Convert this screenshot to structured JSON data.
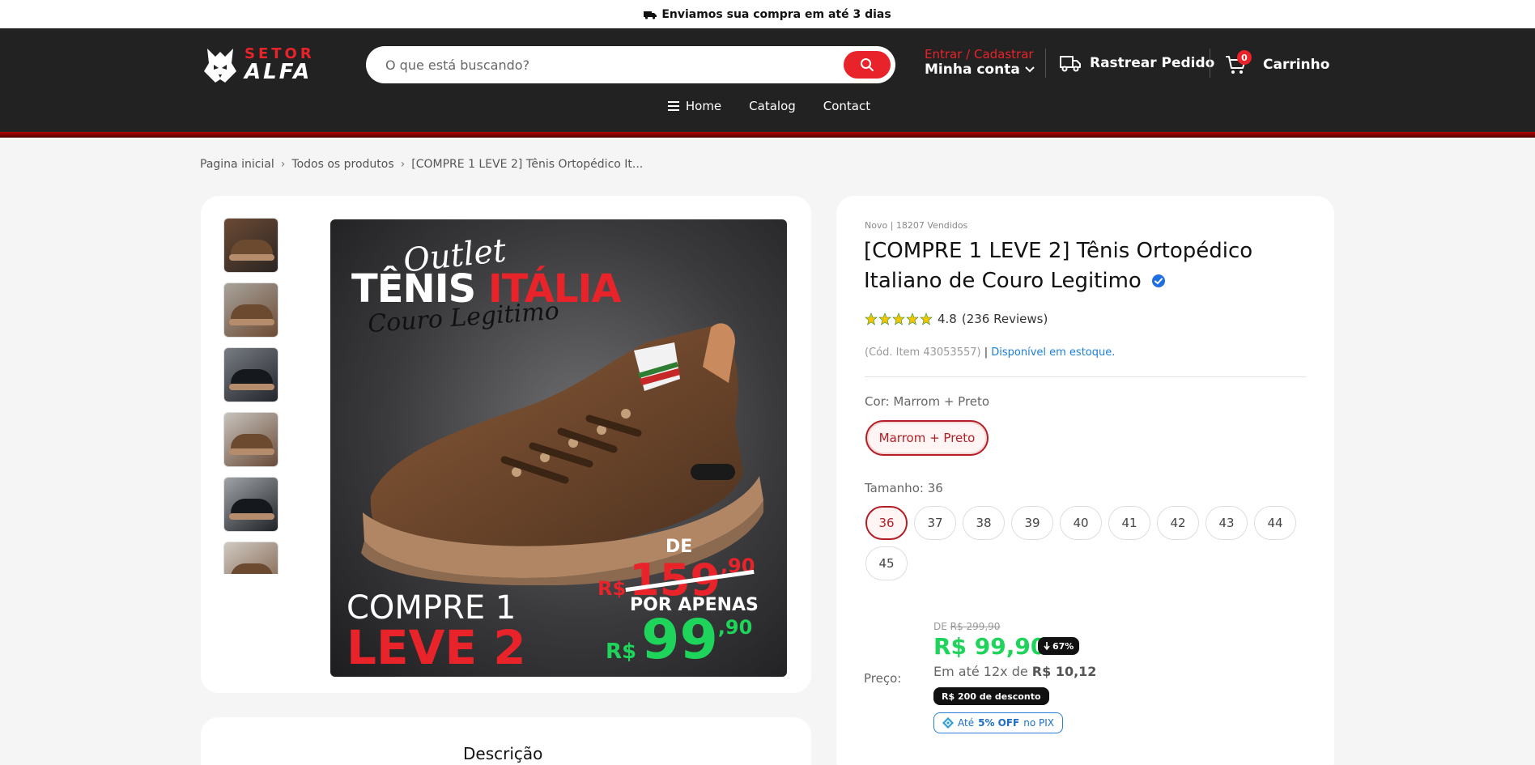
{
  "announcement": {
    "text": "Enviamos sua compra em até 3 dias",
    "icon": "truck-icon"
  },
  "header": {
    "logo": {
      "top": "SETOR",
      "bottom": "ALFA",
      "icon": "wolf-logo-icon"
    },
    "search": {
      "placeholder": "O que está buscando?",
      "value": "",
      "button_icon": "search-icon"
    },
    "account": {
      "top": "Entrar / Cadastrar",
      "bottom": "Minha conta"
    },
    "track": {
      "label": "Rastrear Pedido",
      "icon": "truck-icon"
    },
    "cart": {
      "label": "Carrinho",
      "count": "0",
      "icon": "cart-icon"
    },
    "nav": [
      {
        "label": "Home",
        "icon": "menu-icon"
      },
      {
        "label": "Catalog"
      },
      {
        "label": "Contact"
      }
    ]
  },
  "breadcrumb": [
    "Pagina inicial",
    "Todos os produtos",
    "[COMPRE 1 LEVE 2] Tênis Ortopédico It..."
  ],
  "gallery": {
    "promo": {
      "outlet": "Outlet",
      "tenis_white": "TÊNIS ",
      "tenis_red": "ITÁLIA",
      "couro": "Couro Legitimo",
      "compre": "COMPRE 1",
      "leve": "LEVE 2",
      "de": "DE",
      "old_currency": "R$",
      "old_int": "159",
      "old_dec": ",90",
      "apenas": "POR APENAS",
      "new_currency": "R$",
      "new_int": "99",
      "new_dec": ",90"
    },
    "thumbnail_count": 6
  },
  "description": {
    "title": "Descrição"
  },
  "product": {
    "meta": "Novo | 18207 Vendidos",
    "title": "[COMPRE 1 LEVE 2] Tênis Ortopédico Italiano de Couro Legitimo",
    "rating": {
      "value": "4.8",
      "reviews": "(236 Reviews)",
      "stars": 5
    },
    "sku": "(Cód. Item 43053557)",
    "sku_sep": " | ",
    "availability": "Disponível em estoque.",
    "color": {
      "label": "Cor:",
      "selected": "Marrom + Preto",
      "options": [
        "Marrom + Preto"
      ]
    },
    "size": {
      "label": "Tamanho:",
      "selected": "36",
      "options": [
        "36",
        "37",
        "38",
        "39",
        "40",
        "41",
        "42",
        "43",
        "44",
        "45"
      ]
    },
    "price": {
      "label": "Preço:",
      "old_prefix": "DE",
      "old": "R$ 299,90",
      "current": "R$ 99,90",
      "off": "67%",
      "installments_prefix": "Em até 12x de",
      "installments_value": "R$ 10,12",
      "discount_badge": "R$ 200 de desconto",
      "pix_prefix": "Até",
      "pix_bold": "5% OFF",
      "pix_suffix": "no PIX"
    }
  },
  "colors": {
    "accent_red": "#e8232a",
    "header_bg": "#222222",
    "price_green": "#1ed45a",
    "link_blue": "#1b7fd6"
  }
}
